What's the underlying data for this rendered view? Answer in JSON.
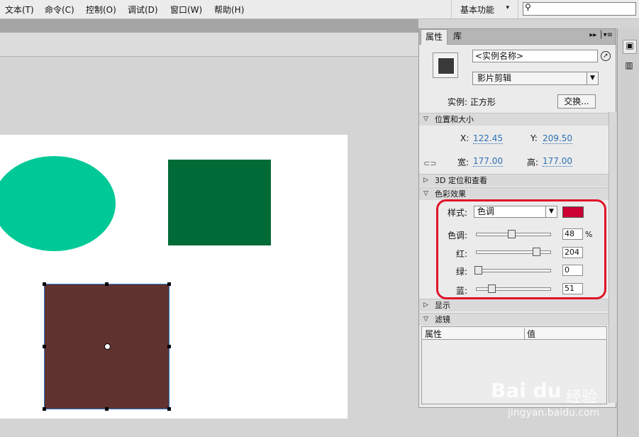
{
  "menu": [
    "文本(T)",
    "命令(C)",
    "控制(O)",
    "调试(D)",
    "窗口(W)",
    "帮助(H)"
  ],
  "workspace": {
    "label": "基本功能",
    "arrow": "▾"
  },
  "search": {
    "icon": "magnifier-icon",
    "glyph": "⚲"
  },
  "panel": {
    "tabs": [
      "属性",
      "库"
    ],
    "instance_name_placeholder": "<实例名称>",
    "type": "影片剪辑",
    "instance_label": "实例:  正方形",
    "swap_label": "交换...",
    "sections": {
      "position_size": "位置和大小",
      "threed": "3D 定位和查看",
      "color": "色彩效果",
      "display": "显示",
      "filter": "滤镜"
    },
    "position": {
      "x_label": "X:",
      "x": "122.45",
      "y_label": "Y:",
      "y": "209.50",
      "w_label": "宽:",
      "w": "177.00",
      "h_label": "高:",
      "h": "177.00"
    },
    "color_effect": {
      "style_label": "样式:",
      "style": "色调",
      "swatch": "#cc0033",
      "tint_label": "色调:",
      "tint": "48",
      "tint_unit": "%",
      "red_label": "红:",
      "red": "204",
      "green_label": "绿:",
      "green": "0",
      "blue_label": "蓝:",
      "blue": "51"
    },
    "filter_headers": [
      "属性",
      "值"
    ]
  },
  "watermark": {
    "brand": "Bai du",
    "brand_cn": "经验",
    "url": "jingyan.baidu.com"
  }
}
